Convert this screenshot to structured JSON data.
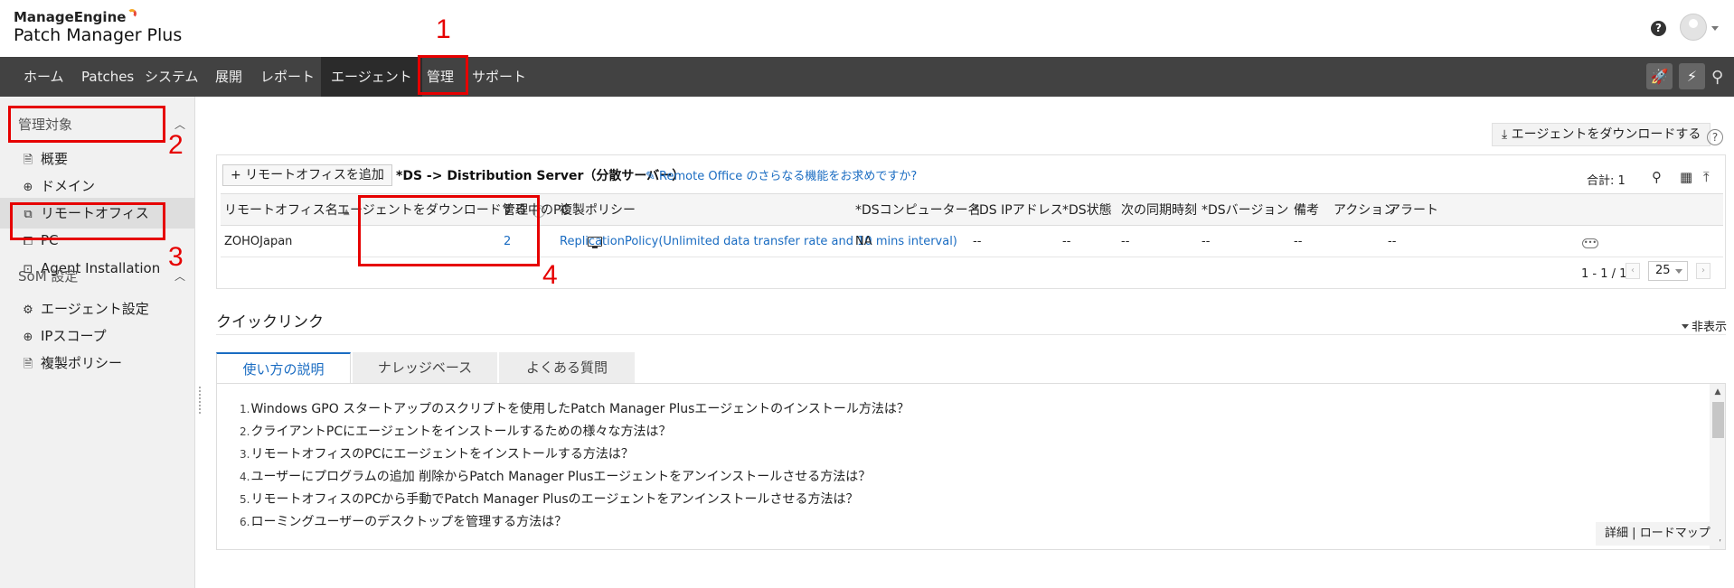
{
  "header": {
    "brand_top": "ManageEngine",
    "brand_main": "Patch Manager Plus",
    "help_label": "?"
  },
  "nav": {
    "items": [
      "ホーム",
      "Patches",
      "システム",
      "展開",
      "レポート",
      "エージェント",
      "管理",
      "サポート"
    ],
    "active": "エージェント"
  },
  "sidebar": {
    "section1": "管理対象",
    "section1_items": [
      "概要",
      "ドメイン",
      "リモートオフィス",
      "PC",
      "Agent Installation"
    ],
    "selected": "リモートオフィス",
    "section2": "SoM 設定",
    "section2_items": [
      "エージェント設定",
      "IPスコープ",
      "複製ポリシー"
    ]
  },
  "toolbar": {
    "download_agent": "エージェントをダウンロードする",
    "help": "?"
  },
  "remote_office": {
    "add_button": "リモートオフィスを追加",
    "ds_note": "*DS -> Distribution Server（分散サーバー）",
    "promo_link": "Remote Office のさらなる機能をお求めですか?",
    "total": "合計: 1",
    "columns": [
      "リモートオフィス名",
      "エージェントをダウンロードする",
      "管理中のPC",
      "複製ポリシー",
      "*DSコンピューター名",
      "*DS IPアドレス",
      "*DS状態",
      "次の同期時刻",
      "*DSバージョン",
      "備考",
      "アクション",
      "アラート"
    ],
    "row": {
      "name": "ZOHOJapan",
      "managed_pcs": "2",
      "policy": "ReplicationPolicy(Unlimited data transfer rate and 10 mins interval)",
      "ds_computer": "NA",
      "ds_ip": "--",
      "ds_status": "--",
      "next_sync": "--",
      "ds_version": "--",
      "remarks": "--",
      "alert": "--"
    },
    "pagination": "1 - 1 / 1",
    "page_size": "25"
  },
  "quicklinks": {
    "title": "クイックリンク",
    "hide": "非表示",
    "tabs": [
      "使い方の説明",
      "ナレッジベース",
      "よくある質問"
    ],
    "items": [
      "Windows GPO スタートアップのスクリプトを使用したPatch Manager Plusエージェントのインストール方法は？",
      "クライアントPCにエージェントをインストールするための様々な方法は？",
      "リモートオフィスのPCにエージェントをインストールする方法は？",
      "ユーザーにプログラムの追加 削除からPatch Manager Plusエージェントをアンインストールさせる方法は？",
      "リモートオフィスのPCから手動でPatch Manager Plusのエージェントをアンインストールさせる方法は？",
      "ローミングユーザーのデスクトップを管理する方法は？"
    ],
    "item_numbers": [
      "1.",
      "2.",
      "3.",
      "4.",
      "5.",
      "6."
    ],
    "footer_details": "詳細",
    "footer_sep": "|",
    "footer_roadmap": "ロードマップ"
  },
  "annotations": [
    "1",
    "2",
    "3",
    "4"
  ],
  "colors": {
    "annotation": "#e60000",
    "link": "#1a6cc2",
    "navbar": "#424242"
  }
}
